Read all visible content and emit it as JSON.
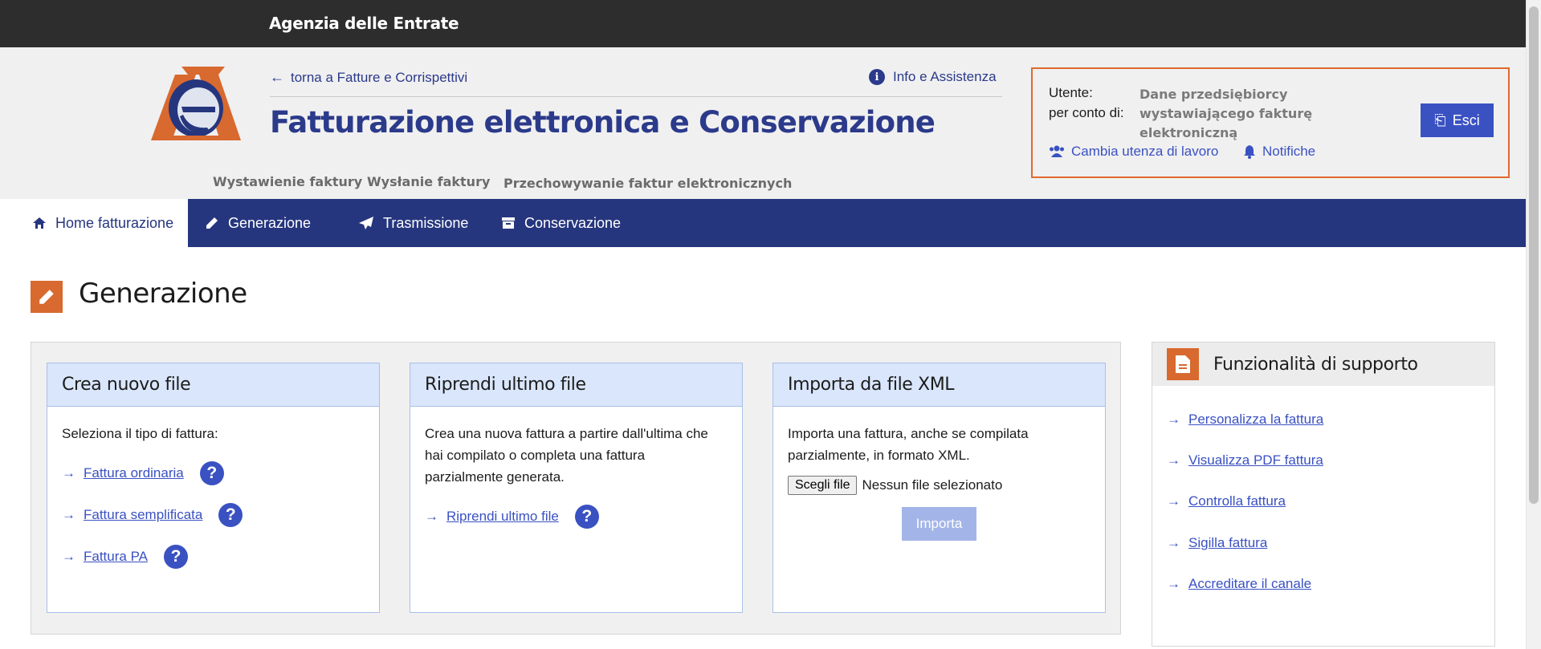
{
  "topbar": {
    "agency": "Agenzia delle Entrate"
  },
  "header": {
    "back_link": "torna a Fatture e Corrispettivi",
    "info_link": "Info e Assistenza",
    "app_title": "Fatturazione elettronica e Conservazione",
    "subnav": [
      "Wystawienie faktury",
      "Wysłanie faktury",
      "Przechowywanie faktur elektronicznych"
    ]
  },
  "user": {
    "utente_label": "Utente:",
    "per_conto_label": "per conto di:",
    "company": "Dane przedsiębiorcy wystawiającego fakturę elektroniczną",
    "logout": "Esci",
    "change_user": "Cambia utenza di lavoro",
    "notifications": "Notifiche"
  },
  "nav": {
    "tabs": [
      {
        "label": "Home fatturazione",
        "icon": "home-icon",
        "active": true
      },
      {
        "label": "Generazione",
        "icon": "pencil-icon",
        "active": false
      },
      {
        "label": "Trasmissione",
        "icon": "paper-plane-icon",
        "active": false
      },
      {
        "label": "Conservazione",
        "icon": "archive-icon",
        "active": false
      }
    ]
  },
  "page": {
    "title": "Generazione",
    "icon": "pencil-icon"
  },
  "cards": {
    "new_file": {
      "title": "Crea nuovo file",
      "text": "Seleziona il tipo di fattura:",
      "links": [
        "Fattura ordinaria",
        "Fattura semplificata",
        "Fattura PA"
      ]
    },
    "resume": {
      "title": "Riprendi ultimo file",
      "text": "Crea una nuova fattura a partire dall'ultima che hai compilato o completa una fattura parzialmente generata.",
      "link": "Riprendi ultimo file"
    },
    "import": {
      "title": "Importa da file XML",
      "text": "Importa una fattura, anche se compilata parzialmente, in formato XML.",
      "choose_file": "Scegli file",
      "no_file": "Nessun file selezionato",
      "import_button": "Importa"
    }
  },
  "support": {
    "title": "Funzionalità di supporto",
    "links": [
      "Personalizza la fattura",
      "Visualizza PDF fattura",
      "Controlla fattura",
      "Sigilla fattura",
      "Accreditare il canale"
    ]
  },
  "colors": {
    "brand_blue": "#26367e",
    "accent_orange": "#d8692f",
    "link_blue": "#3a51c2"
  }
}
